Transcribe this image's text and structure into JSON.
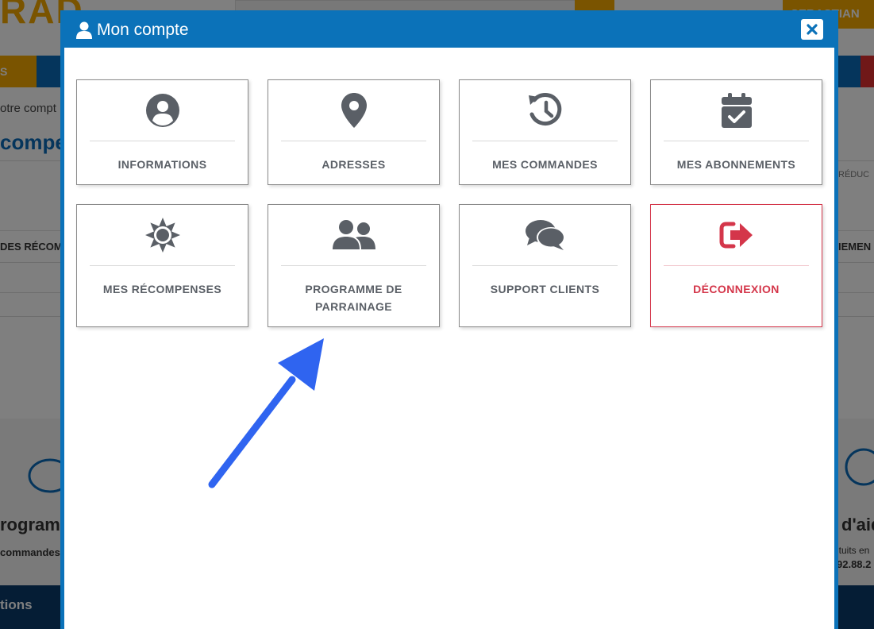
{
  "background": {
    "logo": "RAD",
    "user_button": "SEBASTIAN",
    "nav_left": "S",
    "breadcrumb": "otre compt",
    "heading": "compe",
    "col_left": "DES RÉCOM",
    "col_right_top": "RÉDUC",
    "col_right": "IEMEN",
    "promo_title": "rogramm",
    "promo_sub": "commandes",
    "aid_title": "d'aid",
    "aid_sub": "ituits en",
    "aid_phone": "92.88.2",
    "footer": "tions"
  },
  "modal": {
    "title": "Mon compte",
    "close_icon": "close-icon",
    "tiles": [
      {
        "label": "INFORMATIONS",
        "icon": "user-circle-icon"
      },
      {
        "label": "ADRESSES",
        "icon": "map-marker-icon"
      },
      {
        "label": "MES COMMANDES",
        "icon": "history-icon"
      },
      {
        "label": "MES ABONNEMENTS",
        "icon": "calendar-check-icon"
      },
      {
        "label": "MES RÉCOMPENSES",
        "icon": "sun-icon"
      },
      {
        "label": "PROGRAMME DE PARRAINAGE",
        "icon": "users-icon"
      },
      {
        "label": "SUPPORT CLIENTS",
        "icon": "comments-icon"
      },
      {
        "label": "DÉCONNEXION",
        "icon": "sign-out-icon"
      }
    ]
  },
  "colors": {
    "modal_blue": "#0b72b9",
    "icon_gray": "#5a5f66",
    "logout_red": "#d4364a",
    "arrow_blue": "#2f64f0"
  }
}
